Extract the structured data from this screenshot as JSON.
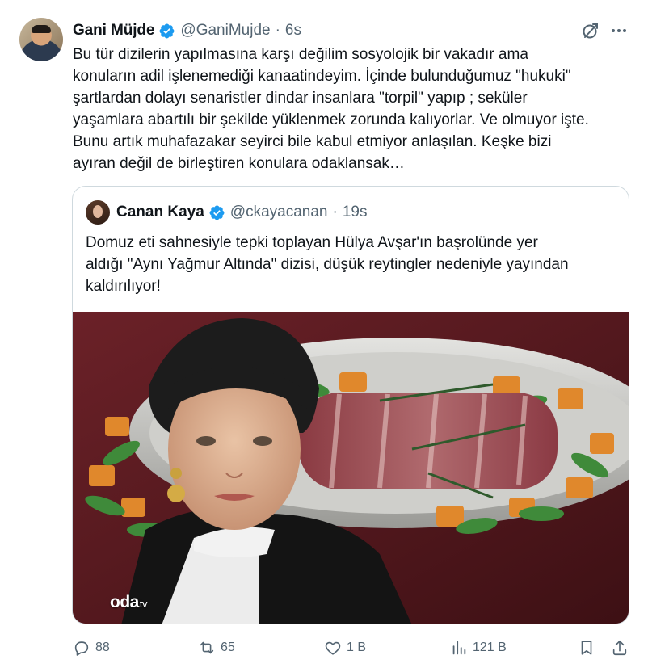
{
  "author": {
    "name": "Gani Müjde",
    "handle": "@GaniMujde",
    "time": "6s",
    "verified": true
  },
  "tweet_text": "Bu tür dizilerin yapılmasına karşı değilim sosyolojik bir vakadır ama\nkonuların adil işlenemediği kanaatindeyim. İçinde bulunduğumuz \"hukuki\"\nşartlardan dolayı senaristler dindar insanlara \"torpil\" yapıp ; seküler\nyaşamlara abartılı bir şekilde yüklenmek zorunda kalıyorlar. Ve olmuyor işte.\nBunu artık muhafazakar seyirci bile kabul etmiyor anlaşılan. Keşke bizi\nayıran değil de birleştiren konulara odaklansak…",
  "quoted": {
    "name": "Canan Kaya",
    "handle": "@ckayacanan",
    "time": "19s",
    "verified": true,
    "text": "Domuz eti sahnesiyle tepki toplayan Hülya Avşar'ın başrolünde yer\naldığı \"Aynı Yağmur Altında\" dizisi, düşük reytingler nedeniyle yayından\nkaldırılıyor!",
    "watermark": "oda",
    "watermark_suffix": "tv"
  },
  "actions": {
    "replies": "88",
    "reposts": "65",
    "likes": "1 B",
    "views": "121 B"
  },
  "icons": [
    "verified-badge-icon",
    "grok-icon",
    "more-icon",
    "reply-icon",
    "repost-icon",
    "like-icon",
    "views-icon",
    "bookmark-icon",
    "share-icon"
  ],
  "colors": {
    "text": "#0f1419",
    "secondary": "#536471",
    "verified": "#1d9bf0",
    "border": "#cfd9de"
  }
}
